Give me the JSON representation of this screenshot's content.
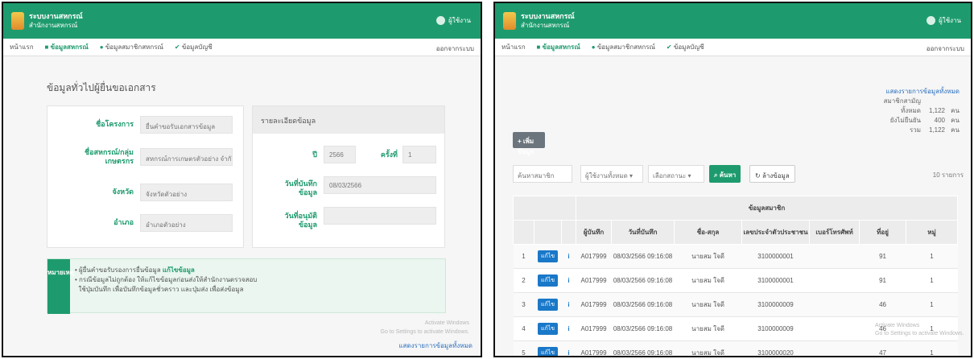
{
  "left": {
    "app": {
      "brand_line1": "ระบบงานสหกรณ์",
      "brand_line2": "สำนักงานสหกรณ์",
      "user": "ผู้ใช้งาน"
    },
    "nav": {
      "home": "หน้าแรก",
      "item1": "ข้อมูลสหกรณ์",
      "item2": "ข้อมูลสมาชิกสหกรณ์",
      "item3": "ข้อมูลบัญชี",
      "right": "ออกจากระบบ"
    },
    "page_title": "ข้อมูลทั่วไปผู้ยื่นขอเอกสาร",
    "form": [
      {
        "label": "ชื่อโครงการ",
        "value": "ยื่นคำขอรับเอกสารข้อมูล"
      },
      {
        "label": "ชื่อสหกรณ์/กลุ่มเกษตรกร",
        "value": "สหกรณ์การเกษตรตัวอย่าง จำกัด"
      },
      {
        "label": "จังหวัด",
        "value": "จังหวัดตัวอย่าง"
      },
      {
        "label": "อำเภอ",
        "value": "อำเภอตัวอย่าง"
      }
    ],
    "status": {
      "header": "รายละเอียดข้อมูล",
      "year_label": "ปี",
      "year_value": "2566",
      "no_label": "ครั้งที่",
      "no_value": "1",
      "date_label": "วันที่บันทึกข้อมูล",
      "date_value": "08/03/2566",
      "approve_label": "วันที่อนุมัติข้อมูล",
      "approve_value": ""
    },
    "notice": {
      "badge": "หมายเหตุ",
      "line1": "ผู้ยื่นคำขอรับรองการยื่นข้อมูล",
      "line1_link": "แก้ไขข้อมูล",
      "line2": "กรณีข้อมูลไม่ถูกต้อง ให้แก้ไขข้อมูลก่อนส่งให้สำนักงานตรวจสอบ",
      "line3": "ใช้ปุ่มบันทึก เพื่อบันทึกข้อมูลชั่วคราว และปุ่มส่ง เพื่อส่งข้อมูล"
    },
    "watermark_l1": "Activate Windows",
    "watermark_l2": "Go to Settings to activate Windows.",
    "bottom_link": "แสดงรายการข้อมูลทั้งหมด"
  },
  "right": {
    "app": {
      "brand_line1": "ระบบงานสหกรณ์",
      "brand_line2": "สำนักงานสหกรณ์",
      "user": "ผู้ใช้งาน"
    },
    "nav": {
      "home": "หน้าแรก",
      "item1": "ข้อมูลสหกรณ์",
      "item2": "ข้อมูลสมาชิกสหกรณ์",
      "item3": "ข้อมูลบัญชี",
      "right": "ออกจากระบบ"
    },
    "summary": {
      "link": "แสดงรายการข้อมูลทั้งหมด",
      "rows": [
        {
          "label": "สมาชิกสามัญทั้งหมด",
          "value": "1,122",
          "unit": "คน"
        },
        {
          "label": "ยังไม่ยืนยัน",
          "value": "400",
          "unit": "คน"
        },
        {
          "label": "รวม",
          "value": "1,122",
          "unit": "คน"
        }
      ]
    },
    "add_button": "+ เพิ่มข้อมูล",
    "filters": {
      "search_placeholder": "ค้นหาสมาชิก",
      "select1": "ผู้ใช้งานทั้งหมด",
      "select2": "เลือกสถานะ",
      "search_btn": "ค้นหา",
      "reset_btn": "ล้างข้อมูล",
      "perpage": "10 รายการ"
    },
    "table": {
      "group_header": "ข้อมูลสมาชิก",
      "headers": [
        "",
        "",
        "",
        "ผู้บันทึก",
        "วันที่บันทึก",
        "ชื่อ-สกุล",
        "เลขประจำตัวประชาชน",
        "เบอร์โทรศัพท์",
        "ที่อยู่",
        "หมู่"
      ],
      "rows": [
        {
          "n": "1",
          "edit": "แก้ไข",
          "id": "A017999",
          "date": "08/03/2566 09:16:08",
          "name": "นายสม ใจดี",
          "pid": "3100000001",
          "phone": "",
          "addr": "91",
          "moo": "1"
        },
        {
          "n": "2",
          "edit": "แก้ไข",
          "id": "A017999",
          "date": "08/03/2566 09:16:08",
          "name": "นายสม ใจดี",
          "pid": "3100000001",
          "phone": "",
          "addr": "91",
          "moo": "1"
        },
        {
          "n": "3",
          "edit": "แก้ไข",
          "id": "A017999",
          "date": "08/03/2566 09:16:08",
          "name": "นายสม ใจดี",
          "pid": "3100000009",
          "phone": "",
          "addr": "46",
          "moo": "1"
        },
        {
          "n": "4",
          "edit": "แก้ไข",
          "id": "A017999",
          "date": "08/03/2566 09:16:08",
          "name": "นายสม ใจดี",
          "pid": "3100000009",
          "phone": "",
          "addr": "46",
          "moo": "1"
        },
        {
          "n": "5",
          "edit": "แก้ไข",
          "id": "A017999",
          "date": "08/03/2566 09:16:08",
          "name": "นายสม ใจดี",
          "pid": "3100000020",
          "phone": "",
          "addr": "47",
          "moo": "1"
        }
      ]
    },
    "watermark_l1": "Activate Windows",
    "watermark_l2": "Go to Settings to activate Windows."
  },
  "colors": {
    "primary": "#1e9b6e",
    "link": "#2a6fbf",
    "edit": "#1a78c8"
  }
}
